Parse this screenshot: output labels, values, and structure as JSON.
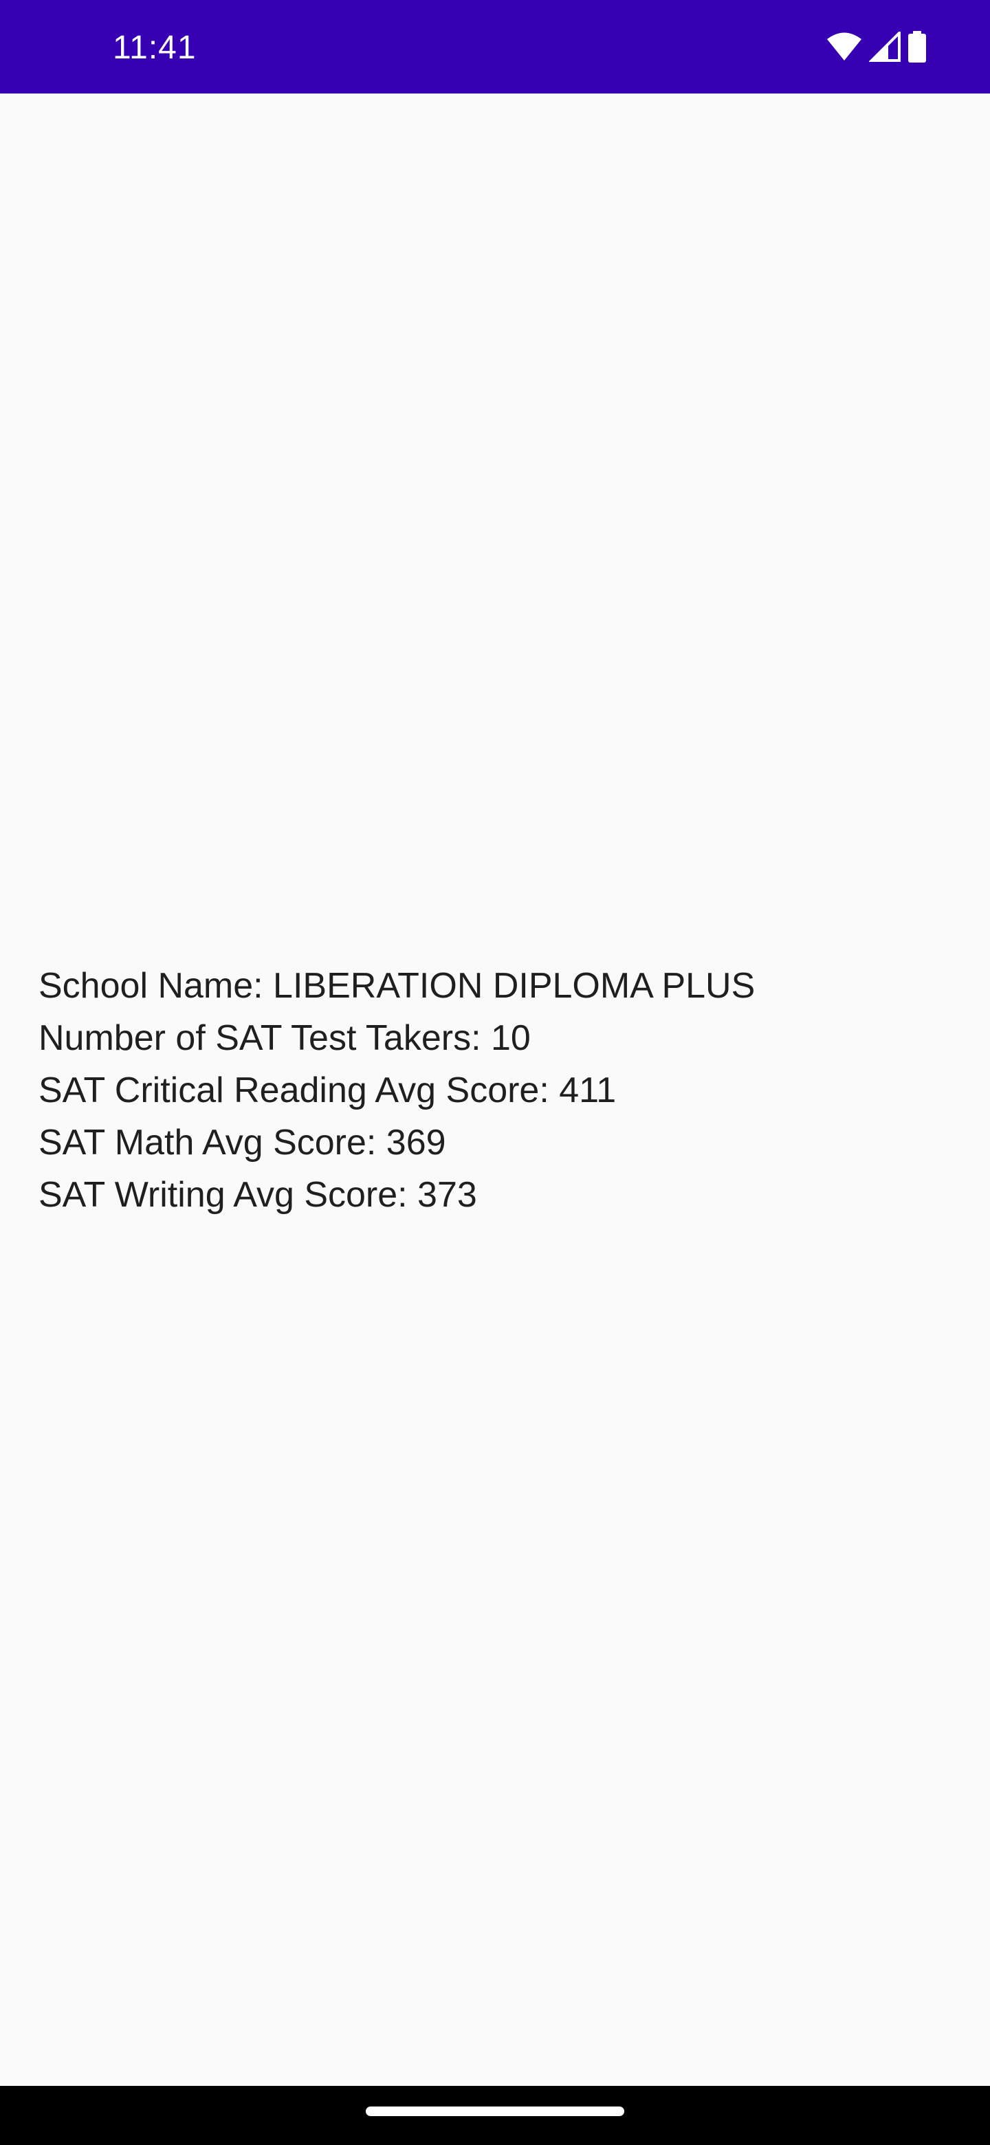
{
  "status_bar": {
    "time": "11:41",
    "background_color": "#3700b3",
    "icons": [
      "wifi-icon",
      "cellular-signal-icon",
      "battery-icon"
    ]
  },
  "school_details": {
    "school_name_line": "School Name: LIBERATION DIPLOMA PLUS",
    "test_takers_line": "Number of SAT Test Takers: 10",
    "reading_score_line": "SAT Critical Reading Avg Score: 411",
    "math_score_line": "SAT Math Avg Score: 369",
    "writing_score_line": "SAT Writing Avg Score: 373"
  },
  "navigation_bar": {
    "background_color": "#000000",
    "handle": "home-gesture-handle"
  }
}
